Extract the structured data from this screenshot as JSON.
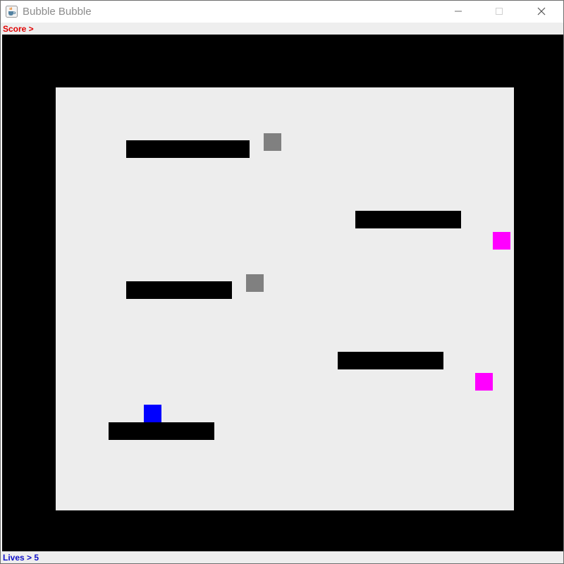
{
  "window": {
    "title": "Bubble Bubble",
    "icon": "java-cup-icon",
    "controls": [
      "minimize-icon",
      "maximize-icon",
      "close-icon"
    ]
  },
  "hud": {
    "score_text": "Score >",
    "lives_text": "Lives > 5",
    "score_color": "#e00000",
    "lives_color": "#1010c8"
  },
  "game": {
    "outer_color": "#000000",
    "arena_color": "#ededed",
    "platform_color": "#000000",
    "player_color": "#0000ff",
    "gray_enemy_color": "#808080",
    "magenta_enemy_color": "#ff00ff",
    "platform_count": 5,
    "gray_enemy_count": 2,
    "magenta_enemy_count": 2,
    "player_count": 1
  }
}
